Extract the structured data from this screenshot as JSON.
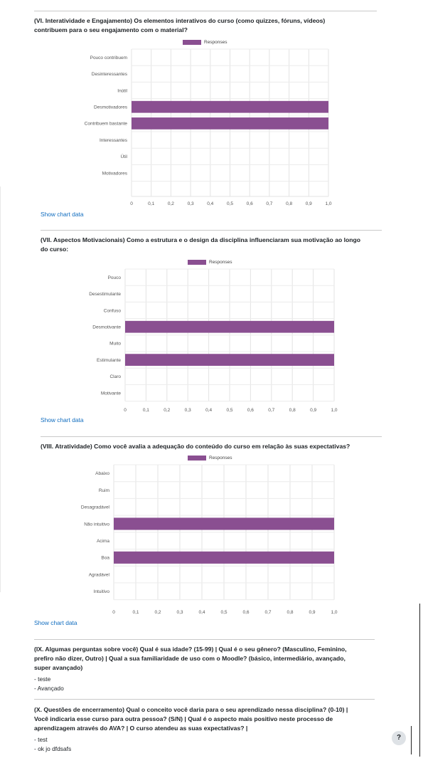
{
  "sections": [
    {
      "title_lines": [
        "(VI. Interatividade e Engajamento) Os elementos interativos do curso (como quizzes, fóruns, vídeos)",
        "contribuem para o seu engajamento com o material?"
      ],
      "show_data_label": "Show chart data"
    },
    {
      "title_lines": [
        "(VII. Aspectos Motivacionais) Como a estrutura e o design da disciplina influenciaram sua motivação ao longo",
        "do curso:"
      ],
      "show_data_label": "Show chart data"
    },
    {
      "title_lines": [
        "(VIII. Atratividade) Como você avalia a adequação do conteúdo do curso em relação às suas expectativas?"
      ],
      "show_data_label": "Show chart data"
    }
  ],
  "chart_data": [
    {
      "type": "bar",
      "orientation": "horizontal",
      "legend": "Responses",
      "categories": [
        "Pouco contribuem",
        "Desinteressantes",
        "Inútil",
        "Desmotivadores",
        "Contribuem bastante",
        "Interessantes",
        "Útil",
        "Motivadores"
      ],
      "values": [
        0,
        0,
        0,
        1,
        1,
        0,
        0,
        0
      ],
      "xlim": [
        0,
        1
      ],
      "xticks": [
        "0",
        "0,1",
        "0,2",
        "0,3",
        "0,4",
        "0,5",
        "0,6",
        "0,7",
        "0,8",
        "0,9",
        "1,0"
      ],
      "color": "#8a4f91",
      "grid": true
    },
    {
      "type": "bar",
      "orientation": "horizontal",
      "legend": "Responses",
      "categories": [
        "Pouco",
        "Desestimulante",
        "Confuso",
        "Desmotivante",
        "Muito",
        "Estimulante",
        "Claro",
        "Motivante"
      ],
      "values": [
        0,
        0,
        0,
        1,
        0,
        1,
        0,
        0
      ],
      "xlim": [
        0,
        1
      ],
      "xticks": [
        "0",
        "0,1",
        "0,2",
        "0,3",
        "0,4",
        "0,5",
        "0,6",
        "0,7",
        "0,8",
        "0,9",
        "1,0"
      ],
      "color": "#8a4f91",
      "grid": true
    },
    {
      "type": "bar",
      "orientation": "horizontal",
      "legend": "Responses",
      "categories": [
        "Abaixo",
        "Ruim",
        "Desagradável",
        "Não intuitivo",
        "Acima",
        "Boa",
        "Agradável",
        "Intuitivo"
      ],
      "values": [
        0,
        0,
        0,
        1,
        0,
        1,
        0,
        0
      ],
      "xlim": [
        0,
        1
      ],
      "xticks": [
        "0",
        "0,1",
        "0,2",
        "0,3",
        "0,4",
        "0,5",
        "0,6",
        "0,7",
        "0,8",
        "0,9",
        "1,0"
      ],
      "color": "#8a4f91",
      "grid": true
    }
  ],
  "text_questions": [
    {
      "title_lines": [
        "(IX. Algumas perguntas sobre você) Qual é sua idade? (15-99) | Qual é o seu gênero? (Masculino, Feminino,",
        "prefiro não dizer, Outro) | Qual a sua familiaridade de uso com o Moodle? (básico, intermediário, avançado,",
        "super avançado)"
      ],
      "answers": [
        "- teste",
        "- Avançado"
      ]
    },
    {
      "title_lines": [
        "(X. Questões de encerramento) Qual o conceito você daria para o seu aprendizado nessa disciplina? (0-10) |",
        "Você indicaria esse curso para outra pessoa? (S/N) | Qual é o aspecto mais positivo neste processo de",
        "aprendizagem através do AVA? | O curso atendeu as suas expectativas? |"
      ],
      "answers": [
        "- test",
        "- ok jo dfdsafs"
      ]
    }
  ],
  "help_button": {
    "label": "?"
  }
}
